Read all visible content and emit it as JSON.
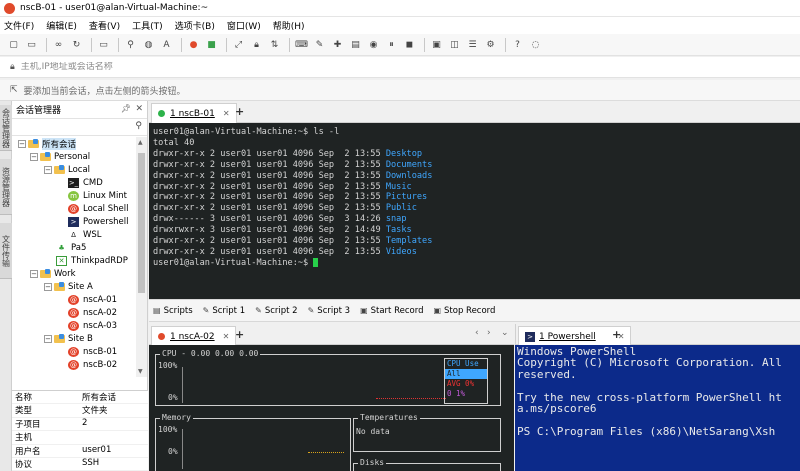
{
  "window": {
    "title": "nscB-01 - user01@alan-Virtual-Machine:~"
  },
  "menu": [
    "文件(F)",
    "编辑(E)",
    "查看(V)",
    "工具(T)",
    "选项卡(B)",
    "窗口(W)",
    "帮助(H)"
  ],
  "address": {
    "placeholder": "主机,IP地址或会话名称"
  },
  "info": {
    "text": "要添加当前会话，点击左侧的箭头按钮。"
  },
  "sidetabs": [
    "会话管理器",
    "资源管理器",
    "文件传输"
  ],
  "session_manager": {
    "title": "会话管理器",
    "tree": [
      {
        "label": "所有会话"
      },
      {
        "label": "Personal"
      },
      {
        "label": "Local"
      },
      {
        "label": "CMD"
      },
      {
        "label": "Linux Mint"
      },
      {
        "label": "Local Shell"
      },
      {
        "label": "Powershell"
      },
      {
        "label": "WSL"
      },
      {
        "label": "Pa5"
      },
      {
        "label": "ThinkpadRDP"
      },
      {
        "label": "Work"
      },
      {
        "label": "Site A"
      },
      {
        "label": "nscA-01"
      },
      {
        "label": "nscA-02"
      },
      {
        "label": "nscA-03"
      },
      {
        "label": "Site B"
      },
      {
        "label": "nscB-01"
      },
      {
        "label": "nscB-02"
      }
    ]
  },
  "properties": [
    {
      "key": "名称",
      "value": "所有会话"
    },
    {
      "key": "类型",
      "value": "文件夹"
    },
    {
      "key": "子项目",
      "value": "2"
    },
    {
      "key": "主机",
      "value": ""
    },
    {
      "key": "用户名",
      "value": "user01"
    },
    {
      "key": "协议",
      "value": "SSH"
    }
  ],
  "tabs_top": [
    {
      "label": "1 nscB-01"
    }
  ],
  "terminal_top": {
    "prompt": "user01@alan-Virtual-Machine:~$ ",
    "command": "ls -l",
    "total": "total 40",
    "entries": [
      {
        "meta": "drwxr-xr-x 2 user01 user01 4096 Sep  2 13:55 ",
        "name": "Desktop"
      },
      {
        "meta": "drwxr-xr-x 2 user01 user01 4096 Sep  2 13:55 ",
        "name": "Documents"
      },
      {
        "meta": "drwxr-xr-x 2 user01 user01 4096 Sep  2 13:55 ",
        "name": "Downloads"
      },
      {
        "meta": "drwxr-xr-x 2 user01 user01 4096 Sep  2 13:55 ",
        "name": "Music"
      },
      {
        "meta": "drwxr-xr-x 2 user01 user01 4096 Sep  2 13:55 ",
        "name": "Pictures"
      },
      {
        "meta": "drwxr-xr-x 2 user01 user01 4096 Sep  2 13:55 ",
        "name": "Public"
      },
      {
        "meta": "drwx------ 3 user01 user01 4096 Sep  3 14:26 ",
        "name": "snap"
      },
      {
        "meta": "drwxrwxr-x 3 user01 user01 4096 Sep  2 14:49 ",
        "name": "Tasks"
      },
      {
        "meta": "drwxr-xr-x 2 user01 user01 4096 Sep  2 13:55 ",
        "name": "Templates"
      },
      {
        "meta": "drwxr-xr-x 2 user01 user01 4096 Sep  2 13:55 ",
        "name": "Videos"
      }
    ],
    "prompt_end": "user01@alan-Virtual-Machine:~$ "
  },
  "scriptbar": [
    "Scripts",
    "Script 1",
    "Script 2",
    "Script 3",
    "Start Record",
    "Stop Record"
  ],
  "tabs_bottom_left": [
    {
      "label": "1 nscA-02"
    }
  ],
  "monitor": {
    "cpu_label": "CPU - 0.00 0.00 0.00",
    "pct_100": "100%",
    "pct_0": "0%",
    "legend_title": "CPU Use",
    "legend_all": "All",
    "legend_avg": "AVG 0%",
    "legend_zero": "0   1%",
    "memory_label": "Memory",
    "temps_label": "Temperatures",
    "temps_value": "No data",
    "disks_label": "Disks"
  },
  "tabs_bottom_right": [
    {
      "label": "1 Powershell"
    }
  ],
  "powershell": {
    "lines": [
      "Windows PowerShell",
      "Copyright (C) Microsoft Corporation. All",
      "reserved.",
      "",
      "Try the new cross-platform PowerShell ht",
      "a.ms/pscore6",
      "",
      "PS C:\\Program Files (x86)\\NetSarang\\Xsh"
    ]
  }
}
